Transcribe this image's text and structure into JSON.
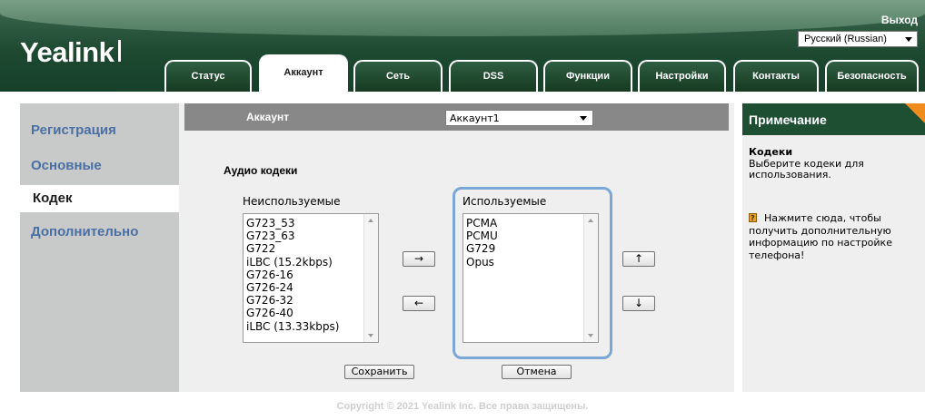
{
  "header": {
    "logo": "Yealink",
    "logout": "Выход",
    "language": "Русский (Russian)"
  },
  "tabs": [
    {
      "label": "Статус"
    },
    {
      "label": "Аккаунт"
    },
    {
      "label": "Сеть"
    },
    {
      "label": "DSS"
    },
    {
      "label": "Функции"
    },
    {
      "label": "Настройки"
    },
    {
      "label": "Контакты"
    },
    {
      "label": "Безопасность"
    }
  ],
  "sidebar": {
    "items": [
      {
        "label": "Регистрация"
      },
      {
        "label": "Основные"
      },
      {
        "label": "Кодек"
      },
      {
        "label": "Дополнительно"
      }
    ]
  },
  "main": {
    "account_label": "Аккаунт",
    "account_value": "Аккаунт1",
    "section_title": "Аудио кодеки",
    "unused_label": "Неиспользуемые",
    "used_label": "Используемые",
    "unused_codecs": [
      "G723_53",
      "G723_63",
      "G722",
      "iLBC (15.2kbps)",
      "G726-16",
      "G726-24",
      "G726-32",
      "G726-40",
      "iLBC (13.33kbps)"
    ],
    "used_codecs": [
      "PCMA",
      "PCMU",
      "G729",
      "Opus"
    ],
    "move_right": "→",
    "move_left": "←",
    "move_up": "↑",
    "move_down": "↓",
    "save": "Сохранить",
    "cancel": "Отмена"
  },
  "note": {
    "title": "Примечание",
    "body_title": "Кодеки",
    "body_text": "Выберите кодеки для использования.",
    "help_text": "Нажмите сюда, чтобы получить дополнительную информацию по настройке телефона!"
  },
  "footer": {
    "copyright": "Copyright © 2021 Yealink Inc. Все права защищены."
  }
}
